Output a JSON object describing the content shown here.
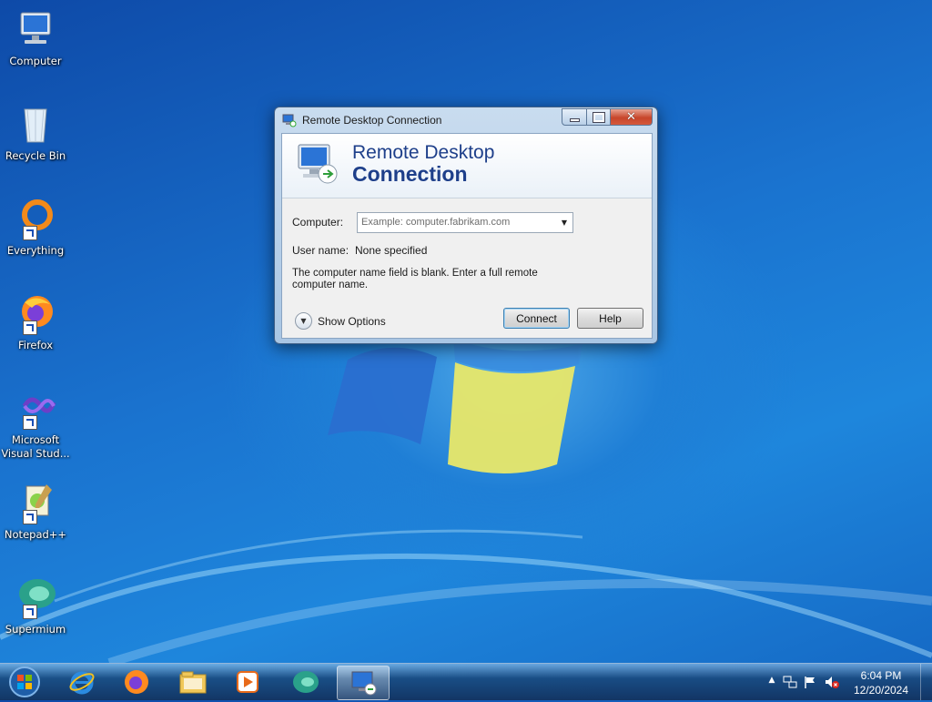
{
  "desktop": {
    "icons": [
      {
        "label": "Computer",
        "icon": "computer-icon"
      },
      {
        "label": "Recycle Bin",
        "icon": "recycle-bin-icon"
      },
      {
        "label": "Everything",
        "icon": "everything-icon"
      },
      {
        "label": "Firefox",
        "icon": "firefox-icon"
      },
      {
        "label": "Microsoft Visual Stud...",
        "icon": "visual-studio-icon"
      },
      {
        "label": "Notepad++",
        "icon": "notepadpp-icon"
      },
      {
        "label": "Supermium",
        "icon": "supermium-icon"
      }
    ]
  },
  "window": {
    "title": "Remote Desktop Connection",
    "banner_line1": "Remote Desktop",
    "banner_line2": "Connection",
    "computer_label": "Computer:",
    "computer_placeholder": "Example: computer.fabrikam.com",
    "username_label": "User name:",
    "username_value": "None specified",
    "message": "The computer name field is blank. Enter a full remote computer name.",
    "show_options": "Show Options",
    "connect_button": "Connect",
    "help_button": "Help"
  },
  "taskbar": {
    "pinned": [
      "start-orb-icon",
      "internet-explorer-icon",
      "firefox-icon",
      "file-explorer-icon",
      "media-player-icon",
      "supermium-icon",
      "remote-desktop-icon"
    ],
    "clock_time": "6:04 PM",
    "clock_date": "12/20/2024"
  },
  "colors": {
    "accent": "#1e3f8a",
    "desktop": "#1a73cf",
    "close_button": "#c7452a"
  }
}
